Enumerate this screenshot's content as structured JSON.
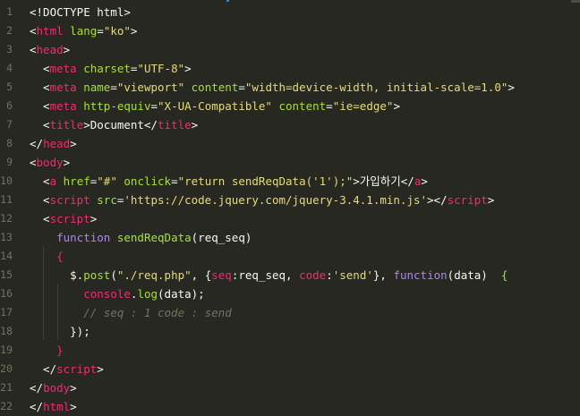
{
  "editor": {
    "lines": [
      {
        "num": "1",
        "tokens": [
          {
            "t": "<!DOCTYPE html>",
            "c": "pl"
          }
        ]
      },
      {
        "num": "2",
        "tokens": [
          {
            "t": "<",
            "c": "pl"
          },
          {
            "t": "html",
            "c": "tag"
          },
          {
            "t": " ",
            "c": "pl"
          },
          {
            "t": "lang",
            "c": "attr"
          },
          {
            "t": "=",
            "c": "pl"
          },
          {
            "t": "\"ko\"",
            "c": "str"
          },
          {
            "t": ">",
            "c": "pl"
          }
        ]
      },
      {
        "num": "3",
        "tokens": [
          {
            "t": "<",
            "c": "pl"
          },
          {
            "t": "head",
            "c": "tag"
          },
          {
            "t": ">",
            "c": "pl"
          }
        ]
      },
      {
        "num": "4",
        "tokens": [
          {
            "t": "  <",
            "c": "pl"
          },
          {
            "t": "meta",
            "c": "tag"
          },
          {
            "t": " ",
            "c": "pl"
          },
          {
            "t": "charset",
            "c": "attr"
          },
          {
            "t": "=",
            "c": "pl"
          },
          {
            "t": "\"UTF-8\"",
            "c": "str"
          },
          {
            "t": ">",
            "c": "pl"
          }
        ]
      },
      {
        "num": "5",
        "tokens": [
          {
            "t": "  <",
            "c": "pl"
          },
          {
            "t": "meta",
            "c": "tag"
          },
          {
            "t": " ",
            "c": "pl"
          },
          {
            "t": "name",
            "c": "attr"
          },
          {
            "t": "=",
            "c": "pl"
          },
          {
            "t": "\"viewport\"",
            "c": "str"
          },
          {
            "t": " ",
            "c": "pl"
          },
          {
            "t": "content",
            "c": "attr"
          },
          {
            "t": "=",
            "c": "pl"
          },
          {
            "t": "\"width=device-width, initial-scale=1.0\"",
            "c": "str"
          },
          {
            "t": ">",
            "c": "pl"
          }
        ]
      },
      {
        "num": "6",
        "tokens": [
          {
            "t": "  <",
            "c": "pl"
          },
          {
            "t": "meta",
            "c": "tag"
          },
          {
            "t": " ",
            "c": "pl"
          },
          {
            "t": "http-equiv",
            "c": "attr"
          },
          {
            "t": "=",
            "c": "pl"
          },
          {
            "t": "\"X-UA-Compatible\"",
            "c": "str"
          },
          {
            "t": " ",
            "c": "pl"
          },
          {
            "t": "content",
            "c": "attr"
          },
          {
            "t": "=",
            "c": "pl"
          },
          {
            "t": "\"ie=edge\"",
            "c": "str"
          },
          {
            "t": ">",
            "c": "pl"
          }
        ]
      },
      {
        "num": "7",
        "tokens": [
          {
            "t": "  <",
            "c": "pl"
          },
          {
            "t": "title",
            "c": "tag"
          },
          {
            "t": ">Document</",
            "c": "pl"
          },
          {
            "t": "title",
            "c": "tag"
          },
          {
            "t": ">",
            "c": "pl"
          }
        ]
      },
      {
        "num": "8",
        "tokens": [
          {
            "t": "</",
            "c": "pl"
          },
          {
            "t": "head",
            "c": "tag"
          },
          {
            "t": ">",
            "c": "pl"
          }
        ]
      },
      {
        "num": "9",
        "tokens": [
          {
            "t": "<",
            "c": "pl"
          },
          {
            "t": "body",
            "c": "tag"
          },
          {
            "t": ">",
            "c": "pl"
          }
        ]
      },
      {
        "num": "10",
        "tokens": [
          {
            "t": "  <",
            "c": "pl"
          },
          {
            "t": "a",
            "c": "tag"
          },
          {
            "t": " ",
            "c": "pl"
          },
          {
            "t": "href",
            "c": "attr"
          },
          {
            "t": "=",
            "c": "pl"
          },
          {
            "t": "\"#\"",
            "c": "str"
          },
          {
            "t": " ",
            "c": "pl"
          },
          {
            "t": "onclick",
            "c": "attr"
          },
          {
            "t": "=",
            "c": "pl"
          },
          {
            "t": "\"return sendReqData('1');\"",
            "c": "str"
          },
          {
            "t": ">가입하기</",
            "c": "pl"
          },
          {
            "t": "a",
            "c": "tag"
          },
          {
            "t": ">",
            "c": "pl"
          }
        ]
      },
      {
        "num": "11",
        "tokens": [
          {
            "t": "  <",
            "c": "pl"
          },
          {
            "t": "script",
            "c": "tag"
          },
          {
            "t": " ",
            "c": "pl"
          },
          {
            "t": "src",
            "c": "attr"
          },
          {
            "t": "=",
            "c": "pl"
          },
          {
            "t": "'https://code.jquery.com/jquery-3.4.1.min.js'",
            "c": "str"
          },
          {
            "t": "></",
            "c": "pl"
          },
          {
            "t": "script",
            "c": "tag"
          },
          {
            "t": ">",
            "c": "pl"
          }
        ]
      },
      {
        "num": "12",
        "tokens": [
          {
            "t": "  <",
            "c": "pl"
          },
          {
            "t": "script",
            "c": "tag"
          },
          {
            "t": ">",
            "c": "pl"
          }
        ]
      },
      {
        "num": "13",
        "tokens": [
          {
            "t": "    ",
            "c": "pl"
          },
          {
            "t": "function",
            "c": "kw"
          },
          {
            "t": " ",
            "c": "pl"
          },
          {
            "t": "sendReqData",
            "c": "fn"
          },
          {
            "t": "(req_seq)",
            "c": "pl"
          }
        ]
      },
      {
        "num": "14",
        "tokens": [
          {
            "t": "    ",
            "c": "pl"
          },
          {
            "t": "{",
            "c": "tag"
          }
        ]
      },
      {
        "num": "15",
        "tokens": [
          {
            "t": "      $.",
            "c": "pl"
          },
          {
            "t": "post",
            "c": "fn"
          },
          {
            "t": "(",
            "c": "pl"
          },
          {
            "t": "\"./req.php\"",
            "c": "str"
          },
          {
            "t": ", {",
            "c": "pl"
          },
          {
            "t": "seq",
            "c": "prop"
          },
          {
            "t": ":req_seq, ",
            "c": "pl"
          },
          {
            "t": "code",
            "c": "prop"
          },
          {
            "t": ":",
            "c": "pl"
          },
          {
            "t": "'send'",
            "c": "str"
          },
          {
            "t": "}, ",
            "c": "pl"
          },
          {
            "t": "function",
            "c": "kw"
          },
          {
            "t": "(data)  ",
            "c": "pl"
          },
          {
            "t": "{",
            "c": "fn"
          }
        ]
      },
      {
        "num": "16",
        "tokens": [
          {
            "t": "        ",
            "c": "pl"
          },
          {
            "t": "console",
            "c": "tag"
          },
          {
            "t": ".",
            "c": "pl"
          },
          {
            "t": "log",
            "c": "fn"
          },
          {
            "t": "(data);",
            "c": "pl"
          }
        ]
      },
      {
        "num": "17",
        "tokens": [
          {
            "t": "        ",
            "c": "pl"
          },
          {
            "t": "// seq : 1 code : send",
            "c": "cm"
          }
        ]
      },
      {
        "num": "18",
        "tokens": [
          {
            "t": "      });",
            "c": "pl"
          }
        ]
      },
      {
        "num": "19",
        "tokens": [
          {
            "t": "    ",
            "c": "pl"
          },
          {
            "t": "}",
            "c": "tag"
          }
        ]
      },
      {
        "num": "20",
        "tokens": [
          {
            "t": "  </",
            "c": "pl"
          },
          {
            "t": "script",
            "c": "tag"
          },
          {
            "t": ">",
            "c": "pl"
          }
        ]
      },
      {
        "num": "21",
        "tokens": [
          {
            "t": "</",
            "c": "pl"
          },
          {
            "t": "body",
            "c": "tag"
          },
          {
            "t": ">",
            "c": "pl"
          }
        ]
      },
      {
        "num": "22",
        "tokens": [
          {
            "t": "</",
            "c": "pl"
          },
          {
            "t": "html",
            "c": "tag"
          },
          {
            "t": ">",
            "c": "pl"
          }
        ]
      }
    ]
  },
  "colors": {
    "background": "#272822",
    "tag": "#f92672",
    "attribute": "#a6e22e",
    "string": "#e6db74",
    "keyword": "#ae81ff",
    "comment": "#75715e",
    "plain": "#f8f8f2"
  }
}
